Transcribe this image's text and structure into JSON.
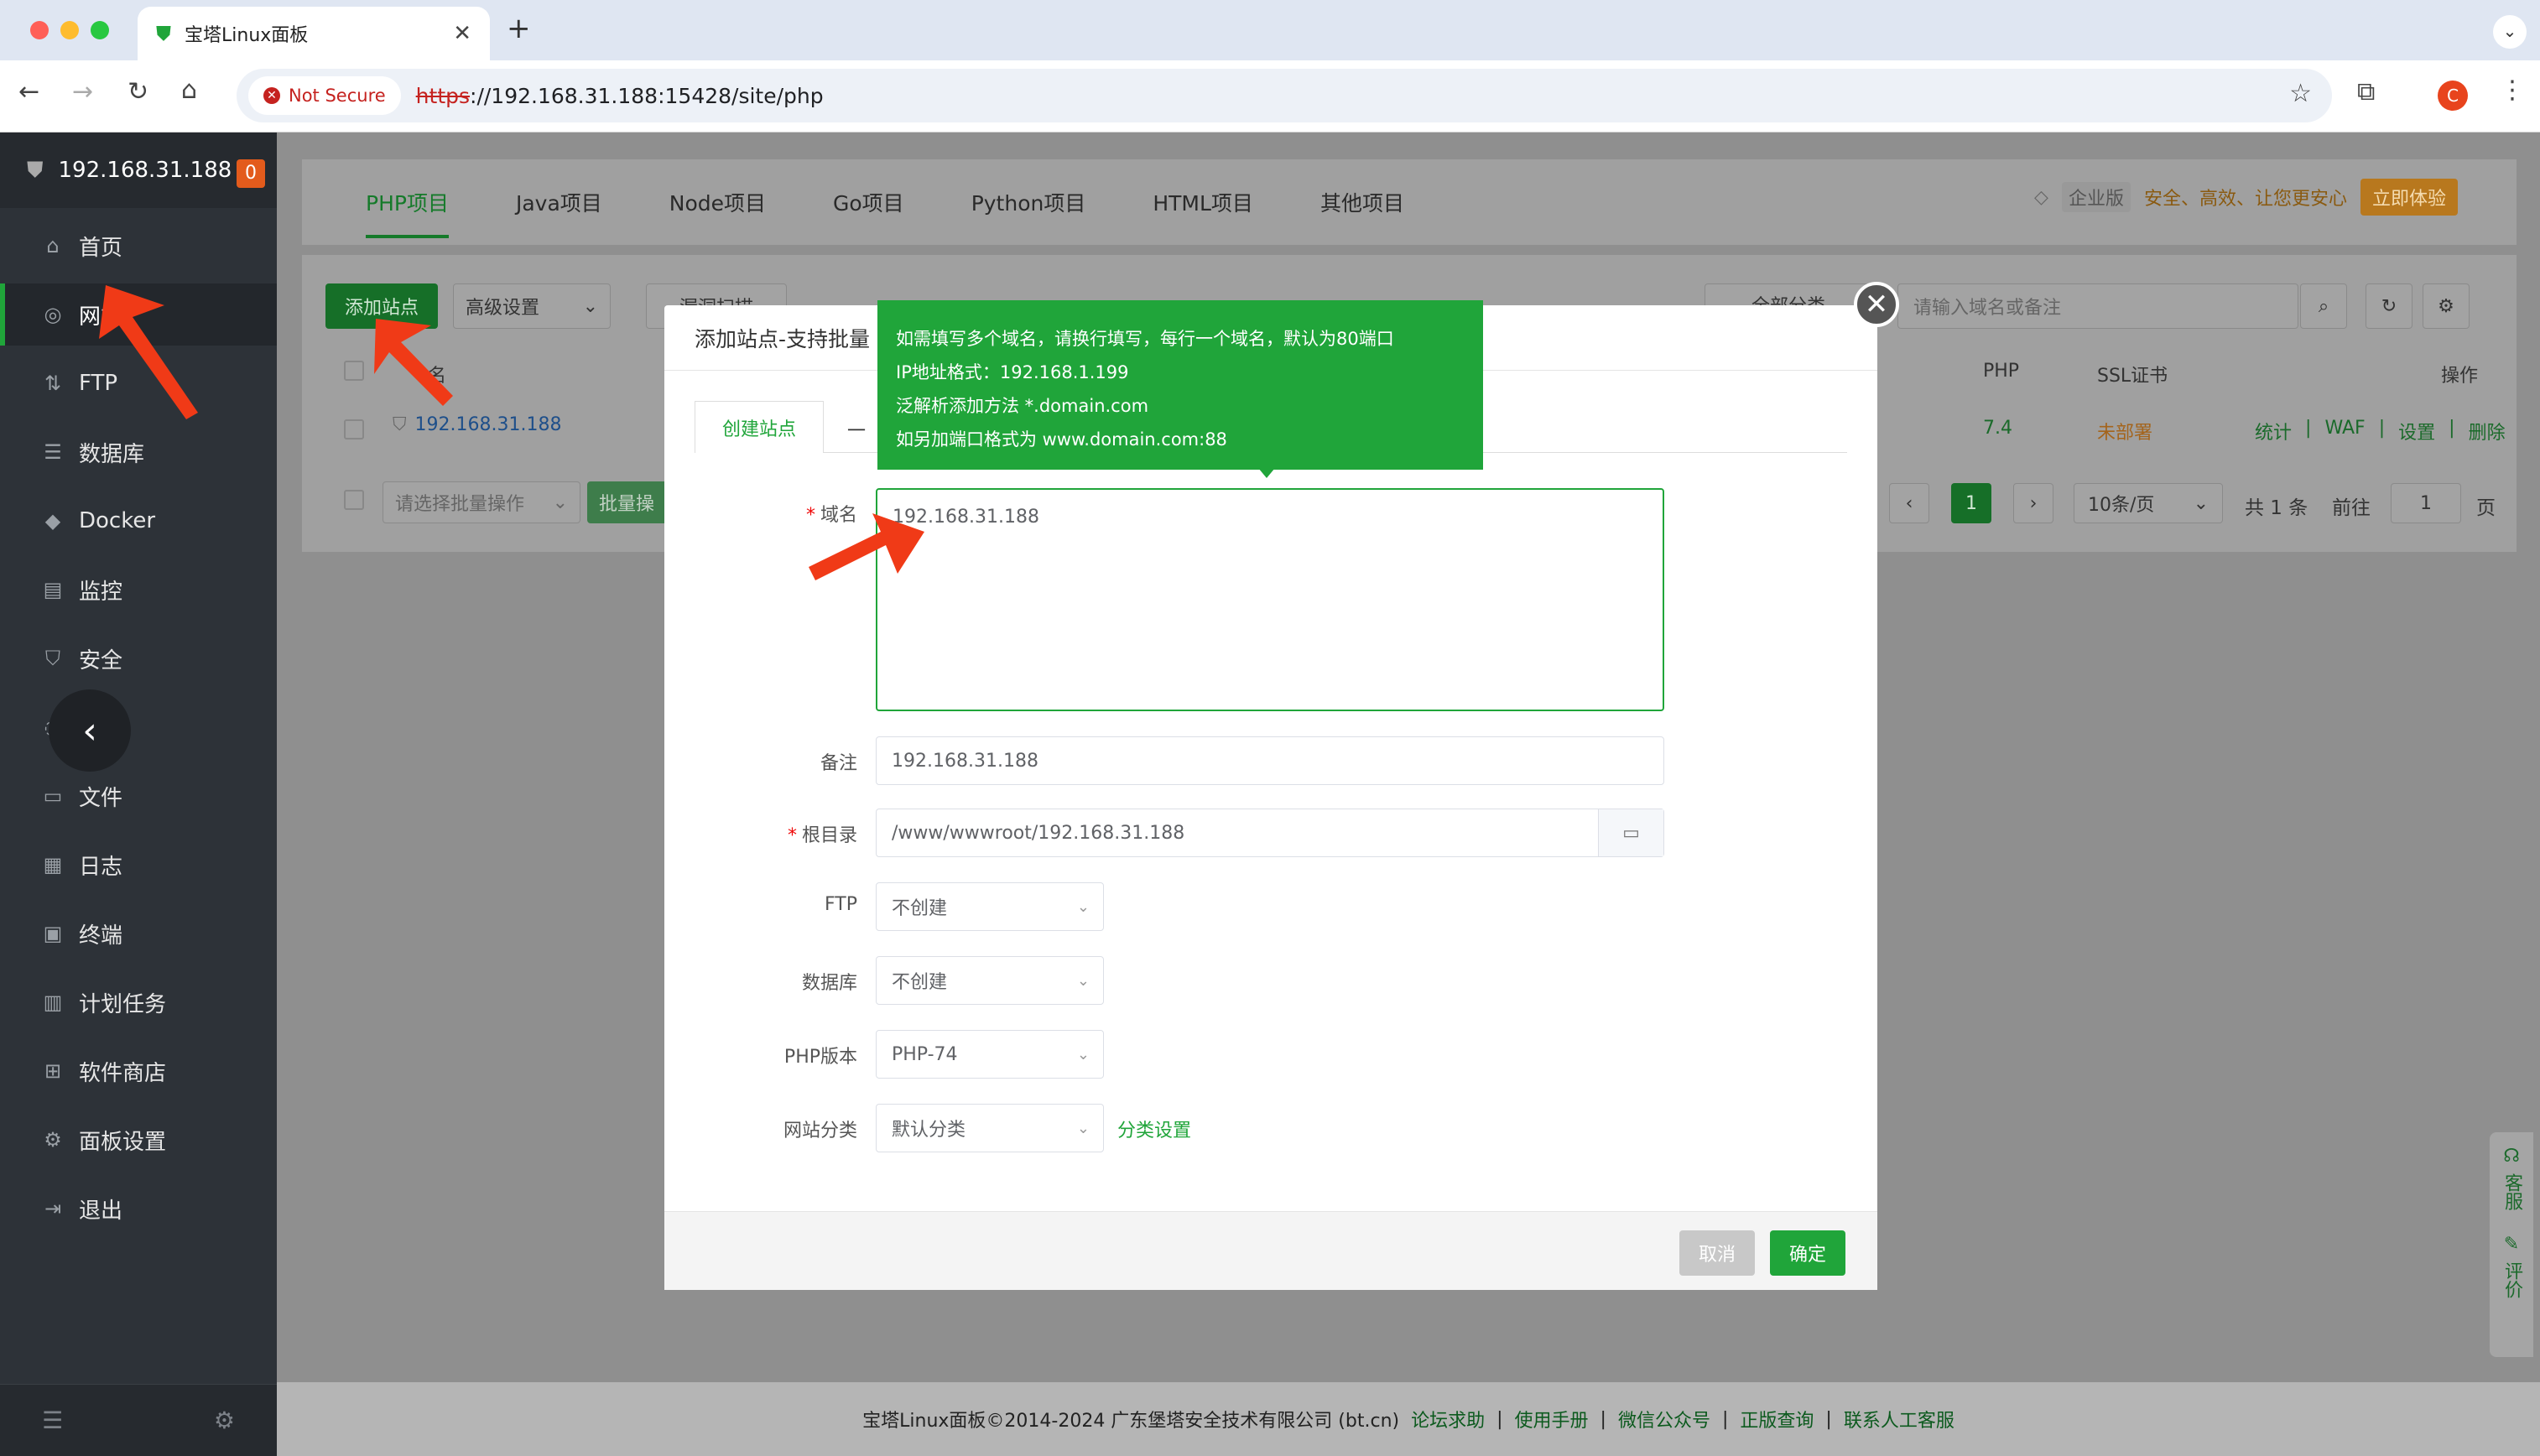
{
  "browser": {
    "tab_title": "宝塔Linux面板",
    "not_secure": "Not Secure",
    "url_scheme": "https",
    "url_rest": "://192.168.31.188:15428/site/php",
    "profile_initial": "C"
  },
  "sidebar": {
    "host": "192.168.31.188",
    "badge": "0",
    "items": [
      {
        "label": "首页"
      },
      {
        "label": "网站"
      },
      {
        "label": "FTP"
      },
      {
        "label": "数据库"
      },
      {
        "label": "Docker"
      },
      {
        "label": "监控"
      },
      {
        "label": "安全"
      },
      {
        "label": ""
      },
      {
        "label": "文件"
      },
      {
        "label": "日志"
      },
      {
        "label": "终端"
      },
      {
        "label": "计划任务"
      },
      {
        "label": "软件商店"
      },
      {
        "label": "面板设置"
      },
      {
        "label": "退出"
      }
    ]
  },
  "project_tabs": [
    "PHP项目",
    "Java项目",
    "Node项目",
    "Go项目",
    "Python项目",
    "HTML项目",
    "其他项目"
  ],
  "ad": {
    "badge": "企业版",
    "text": "安全、高效、让您更安心",
    "button": "立即体验"
  },
  "toolbar": {
    "add_site": "添加站点",
    "advanced": "高级设置",
    "scan": "漏洞扫描",
    "category": "全部分类",
    "search_placeholder": "请输入域名或备注"
  },
  "table": {
    "col_name": "名",
    "col_php": "PHP",
    "col_ssl": "SSL证书",
    "col_ops": "操作",
    "row": {
      "name": "192.168.31.188",
      "php": "7.4",
      "ssl": "未部署",
      "ops": [
        "统计",
        "WAF",
        "设置",
        "删除"
      ]
    },
    "batch_placeholder": "请选择批量操作",
    "batch_btn": "批量操",
    "page": "1",
    "per_page": "10条/页",
    "total": "共 1 条",
    "goto": "前往",
    "goto_page": "1",
    "page_unit": "页"
  },
  "modal": {
    "title": "添加站点-支持批量",
    "tab_create": "创建站点",
    "tab_other": "一",
    "domain_label": "域名",
    "domain_value": "192.168.31.188",
    "remark_label": "备注",
    "remark_value": "192.168.31.188",
    "root_label": "根目录",
    "root_value": "/www/wwwroot/192.168.31.188",
    "ftp_label": "FTP",
    "ftp_value": "不创建",
    "db_label": "数据库",
    "db_value": "不创建",
    "php_label": "PHP版本",
    "php_value": "PHP-74",
    "cat_label": "网站分类",
    "cat_value": "默认分类",
    "cat_link": "分类设置",
    "cancel": "取消",
    "confirm": "确定"
  },
  "tooltip": [
    "如需填写多个域名，请换行填写，每行一个域名，默认为80端口",
    "IP地址格式：192.168.1.199",
    "泛解析添加方法 *.domain.com",
    "如另加端口格式为 www.domain.com:88"
  ],
  "footer": {
    "copyright": "宝塔Linux面板©2014-2024 广东堡塔安全技术有限公司 (bt.cn)",
    "links": [
      "论坛求助",
      "使用手册",
      "微信公众号",
      "正版查询",
      "联系人工客服"
    ]
  },
  "float": {
    "service": "客服",
    "review": "评价"
  },
  "colors": {
    "brand": "#20a53a",
    "sidebar": "#2d3238",
    "annotation": "#f03a17"
  }
}
